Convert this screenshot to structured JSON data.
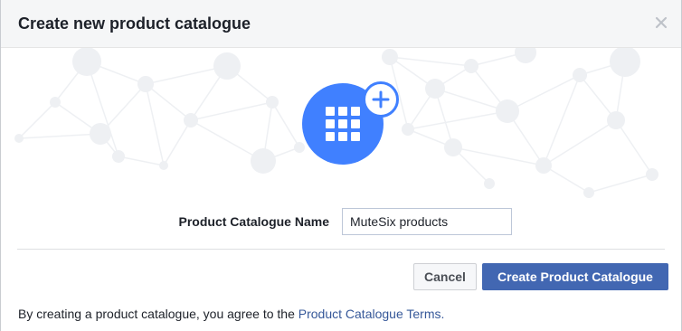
{
  "dialog": {
    "title": "Create new product catalogue",
    "close_icon": "close-icon"
  },
  "hero": {
    "main_icon": "grid-icon",
    "badge_icon": "plus-icon",
    "accent_color": "#4080ff"
  },
  "form": {
    "label": "Product Catalogue Name",
    "input_value": "MuteSix products"
  },
  "buttons": {
    "cancel": "Cancel",
    "create": "Create Product Catalogue",
    "primary_color": "#4267b2"
  },
  "footer": {
    "text": "By creating a product catalogue, you agree to the ",
    "link": "Product Catalogue Terms."
  }
}
